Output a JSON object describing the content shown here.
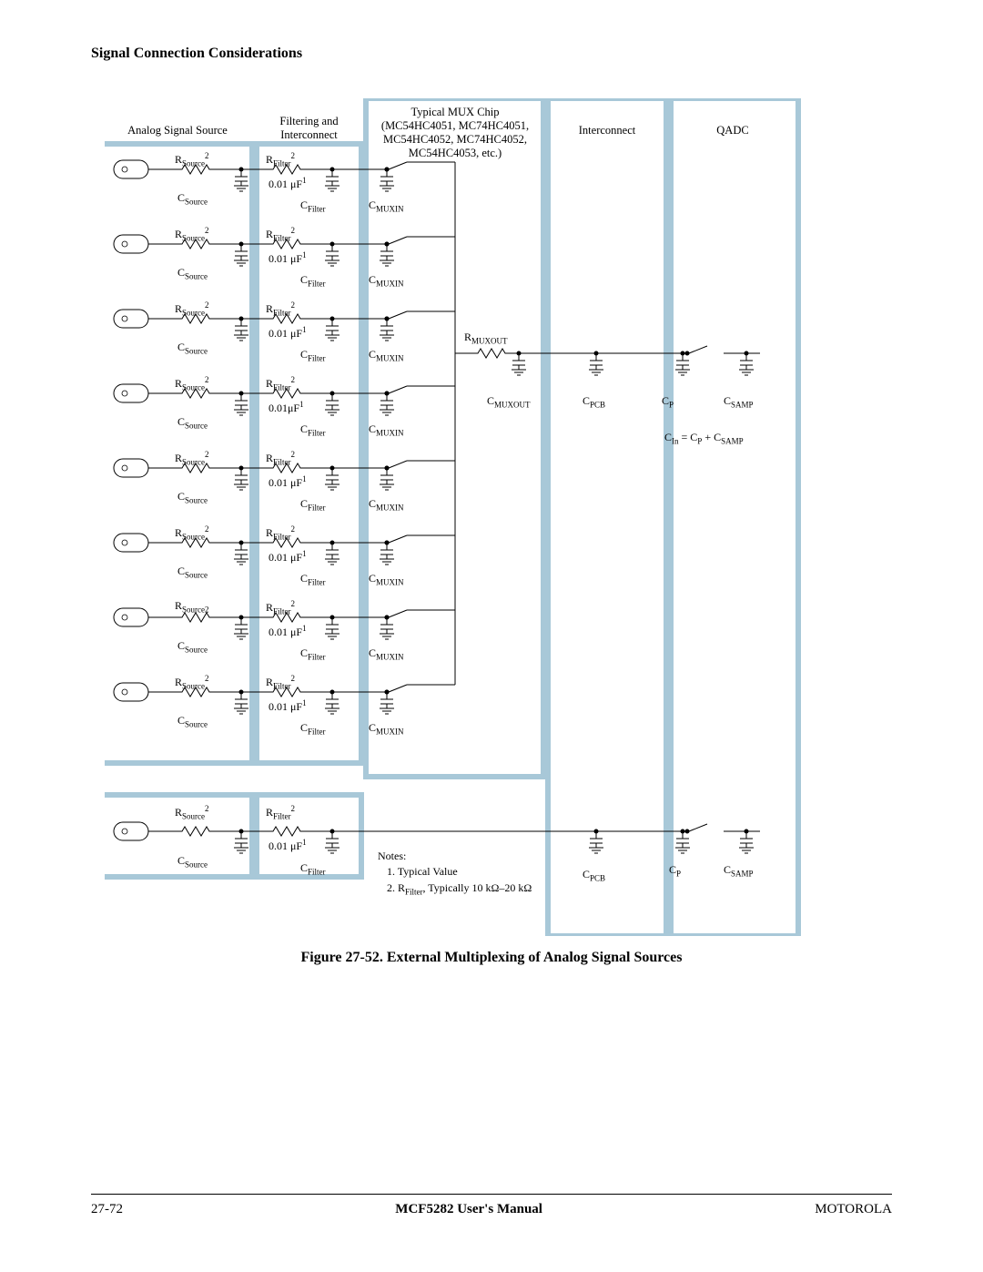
{
  "header": "Signal Connection Considerations",
  "boxes": {
    "analog_source": "Analog Signal Source",
    "filter_interconnect": "Filtering and\nInterconnect",
    "mux_chip_line1": "Typical MUX Chip",
    "mux_chip_line2": "(MC54HC4051, MC74HC4051,",
    "mux_chip_line3": "MC54HC4052, MC74HC4052,",
    "mux_chip_line4": "MC54HC4053, etc.)",
    "interconnect": "Interconnect",
    "qadc": "QADC"
  },
  "channel": {
    "r_source": "R",
    "r_source_sub": "Source",
    "r_source_sup": "2",
    "c_source": "C",
    "c_source_sub": "Source",
    "r_filter": "R",
    "r_filter_sub": "Filter",
    "r_filter_sup": "2",
    "cap_val": "0.01 μF",
    "cap_val_sup": "1",
    "c_filter": "C",
    "c_filter_sub": "Filter",
    "c_muxin": "C",
    "c_muxin_sub": "MUXIN"
  },
  "output": {
    "r_muxout": "R",
    "r_muxout_sub": "MUXOUT",
    "c_muxout": "C",
    "c_muxout_sub": "MUXOUT",
    "c_pcb": "C",
    "c_pcb_sub": "PCB",
    "c_p": "C",
    "c_p_sub": "P",
    "c_samp": "C",
    "c_samp_sub": "SAMP",
    "c_in_eq": "C",
    "c_in_eq_full": " = C",
    "c_in_eq_plus": " + C",
    "c_in_sub": "In",
    "c_p_sub2": "P",
    "c_samp_sub2": "SAMP"
  },
  "notes": {
    "heading": "Notes:",
    "note1": "1. Typical Value",
    "note2_a": "2. R",
    "note2_sub": "Filter",
    "note2_b": ", Typically 10 kΩ–20 kΩ"
  },
  "figure_caption": "Figure 27-52. External Multiplexing of Analog Signal Sources",
  "footer": {
    "page": "27-72",
    "manual": "MCF5282 User's Manual",
    "company": "MOTOROLA"
  }
}
